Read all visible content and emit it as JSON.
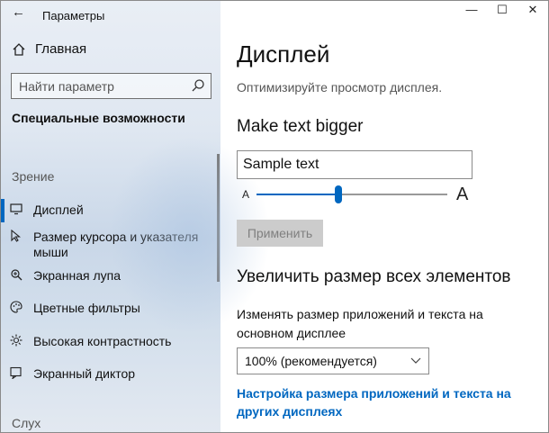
{
  "window": {
    "title": "Параметры",
    "back_icon": "←",
    "controls": {
      "minimize": "—",
      "maximize": "☐",
      "close": "✕"
    }
  },
  "sidebar": {
    "home_label": "Главная",
    "search_placeholder": "Найти параметр",
    "section_heading": "Специальные возможности",
    "group_vision": "Зрение",
    "items": [
      {
        "label": "Дисплей",
        "icon": "display-icon",
        "active": true
      },
      {
        "label": "Размер курсора и указателя мыши",
        "icon": "cursor-icon",
        "active": false
      },
      {
        "label": "Экранная лупа",
        "icon": "magnifier-icon",
        "active": false
      },
      {
        "label": "Цветные фильтры",
        "icon": "palette-icon",
        "active": false
      },
      {
        "label": "Высокая контрастность",
        "icon": "contrast-icon",
        "active": false
      },
      {
        "label": "Экранный диктор",
        "icon": "narrator-icon",
        "active": false
      }
    ],
    "group_hearing": "Слух"
  },
  "main": {
    "title": "Дисплей",
    "subtitle": "Оптимизируйте просмотр дисплея.",
    "text_bigger_heading": "Make text bigger",
    "sample_text": "Sample text",
    "slider_small_label": "A",
    "slider_big_label": "A",
    "slider_level": 0.43,
    "apply_button": "Применить",
    "everything_bigger_heading": "Увеличить размер всех элементов",
    "scale_description": "Изменять размер приложений и текста на основном дисплее",
    "scale_value": "100% (рекомендуется)",
    "other_displays_link": "Настройка размера приложений и текста на других дисплеях"
  },
  "colors": {
    "accent": "#0067c0",
    "sidebar_bg": "#dfe7f1",
    "disabled_button": "#cccccc"
  }
}
